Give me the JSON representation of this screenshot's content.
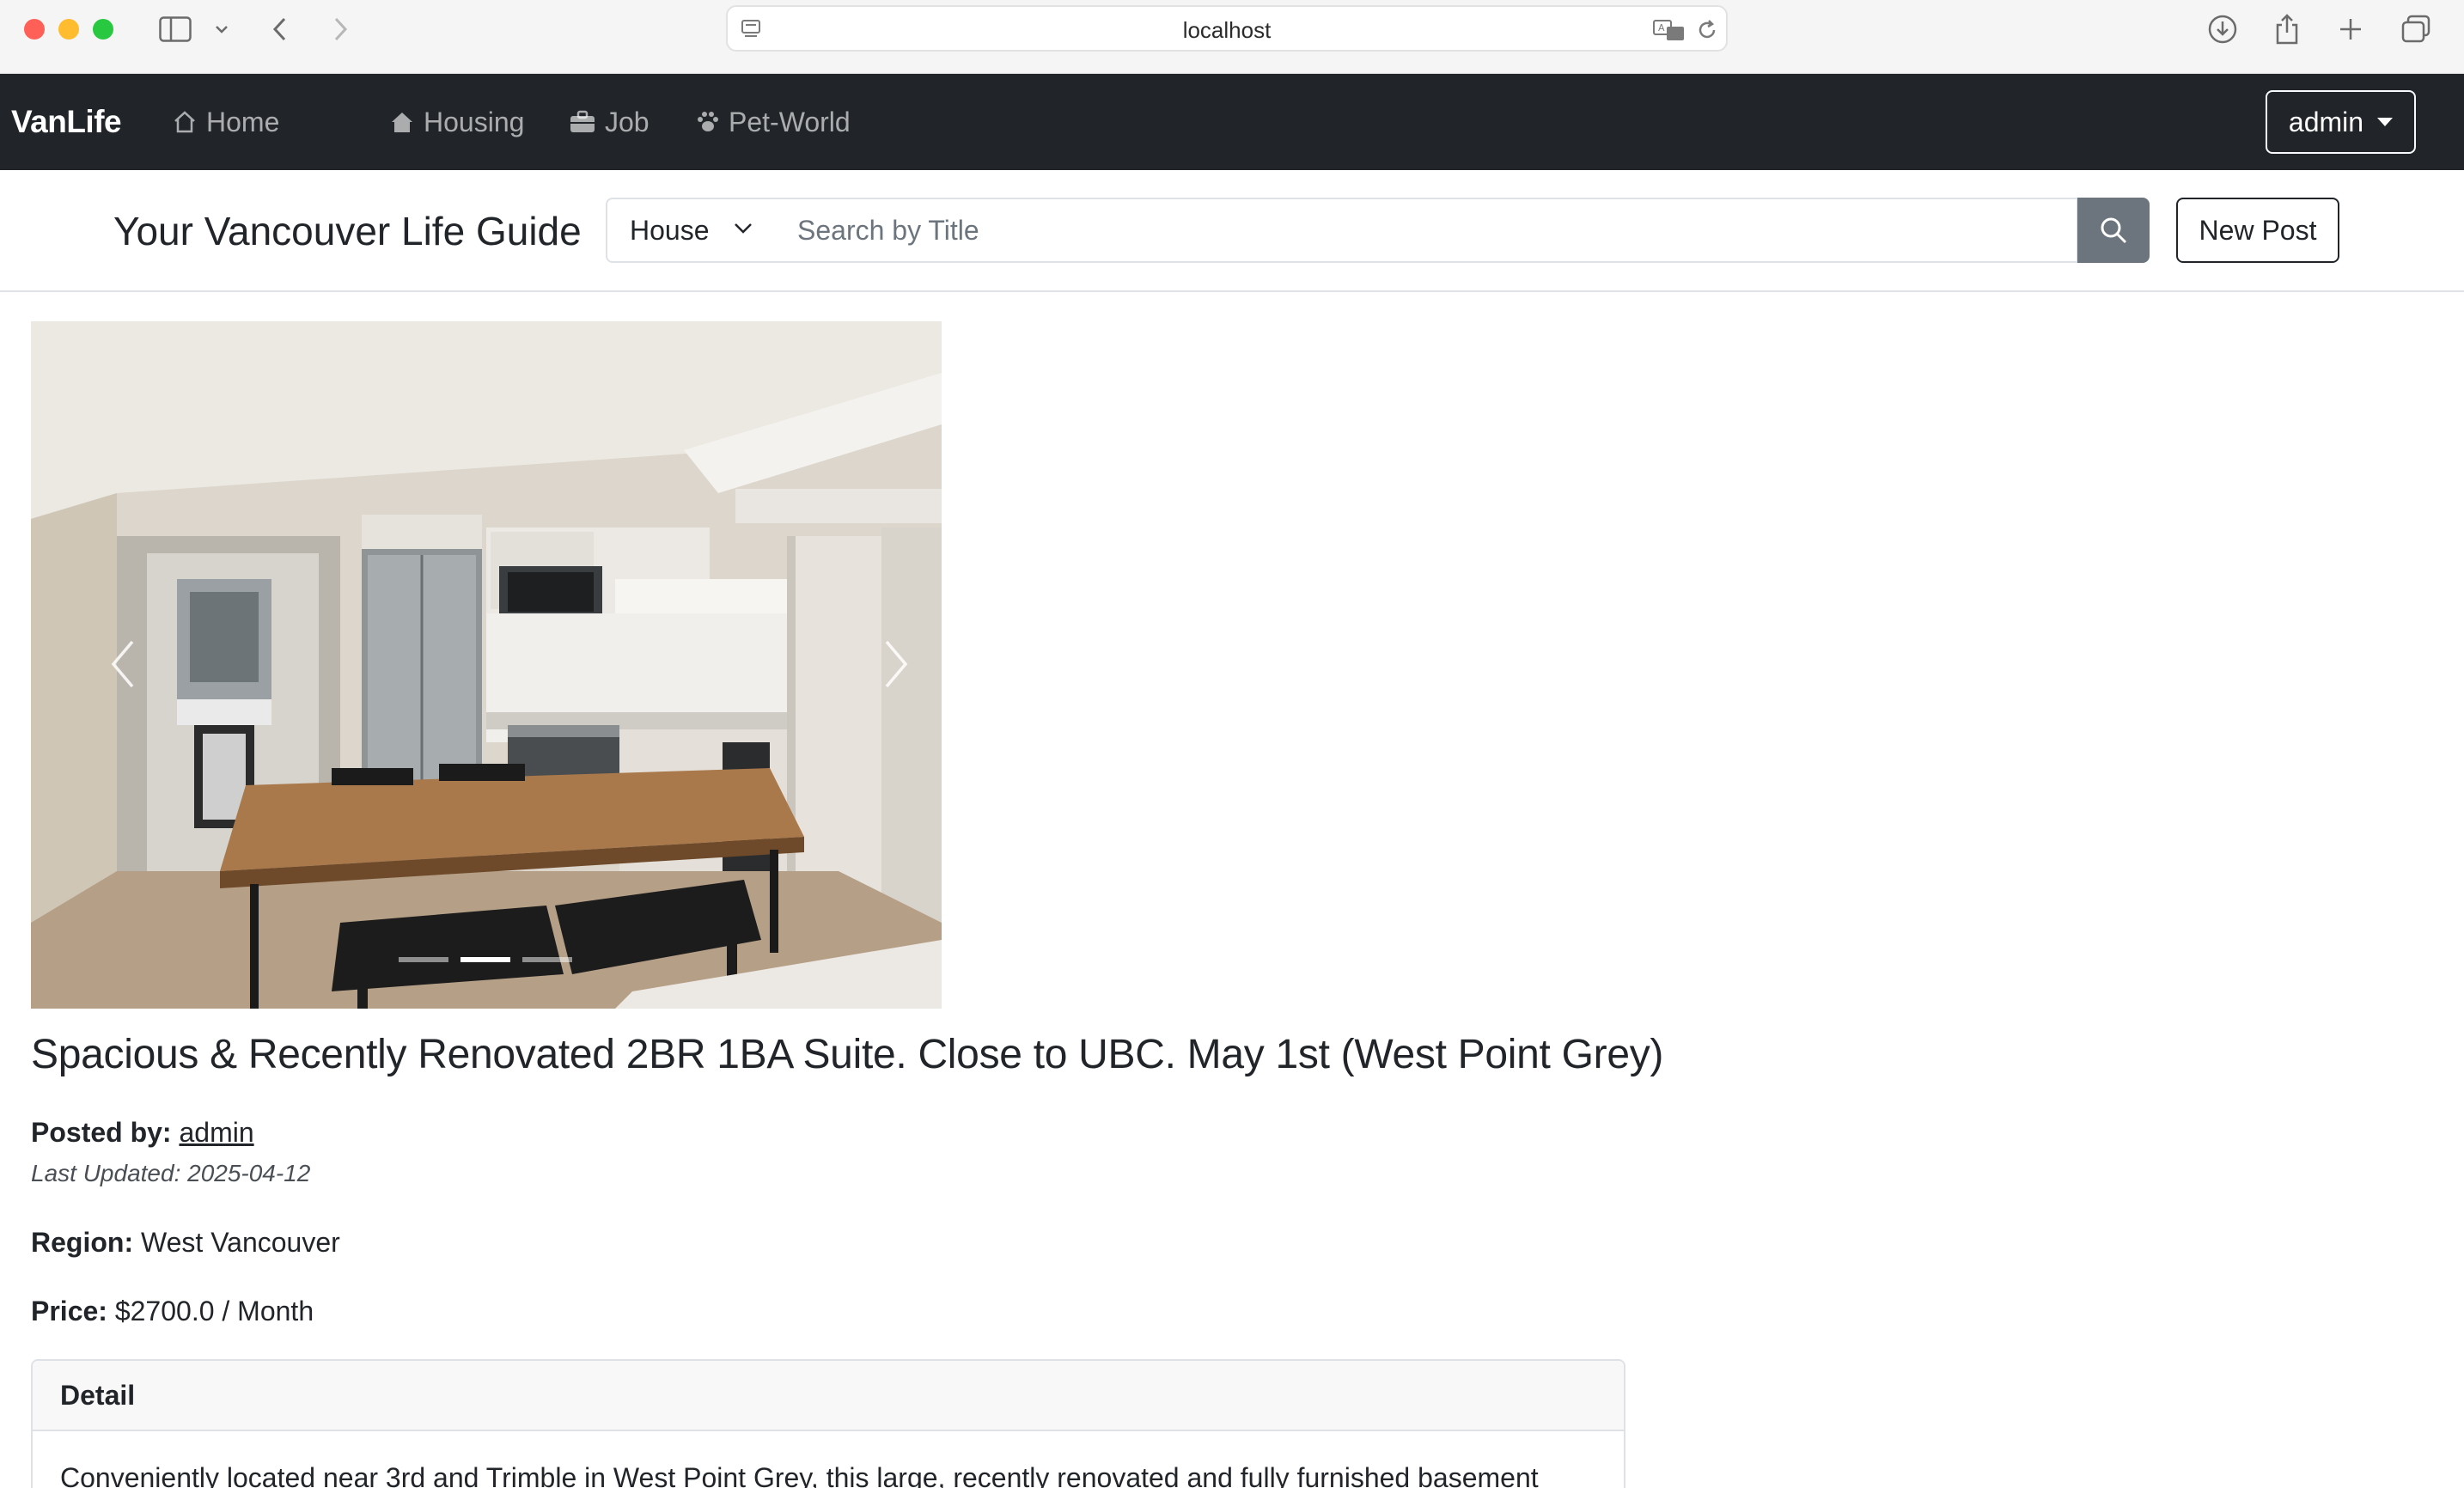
{
  "browser": {
    "url": "localhost"
  },
  "nav": {
    "brand": "VanLife",
    "home": "Home",
    "housing": "Housing",
    "job": "Job",
    "pet_world": "Pet-World",
    "user": "admin"
  },
  "search": {
    "title": "Your Vancouver Life Guide",
    "category": "House",
    "placeholder": "Search by Title",
    "new_post": "New Post"
  },
  "carousel": {
    "slide_count": 3,
    "active_index": 1
  },
  "post": {
    "title": "Spacious & Recently Renovated 2BR 1BA Suite. Close to UBC. May 1st (West Point Grey)",
    "posted_by_label": "Posted by:",
    "posted_by": "admin",
    "last_updated": "Last Updated: 2025-04-12",
    "region_label": "Region:",
    "region": "West Vancouver",
    "price_label": "Price:",
    "price": "$2700.0 / Month",
    "detail_header": "Detail",
    "detail_text": "Conveniently located near 3rd and Trimble in West Point Grey, this large, recently renovated and fully furnished basement"
  },
  "colors": {
    "navbar": "#212529",
    "search_button": "#6c757d",
    "page_bg": "#ffffff"
  }
}
